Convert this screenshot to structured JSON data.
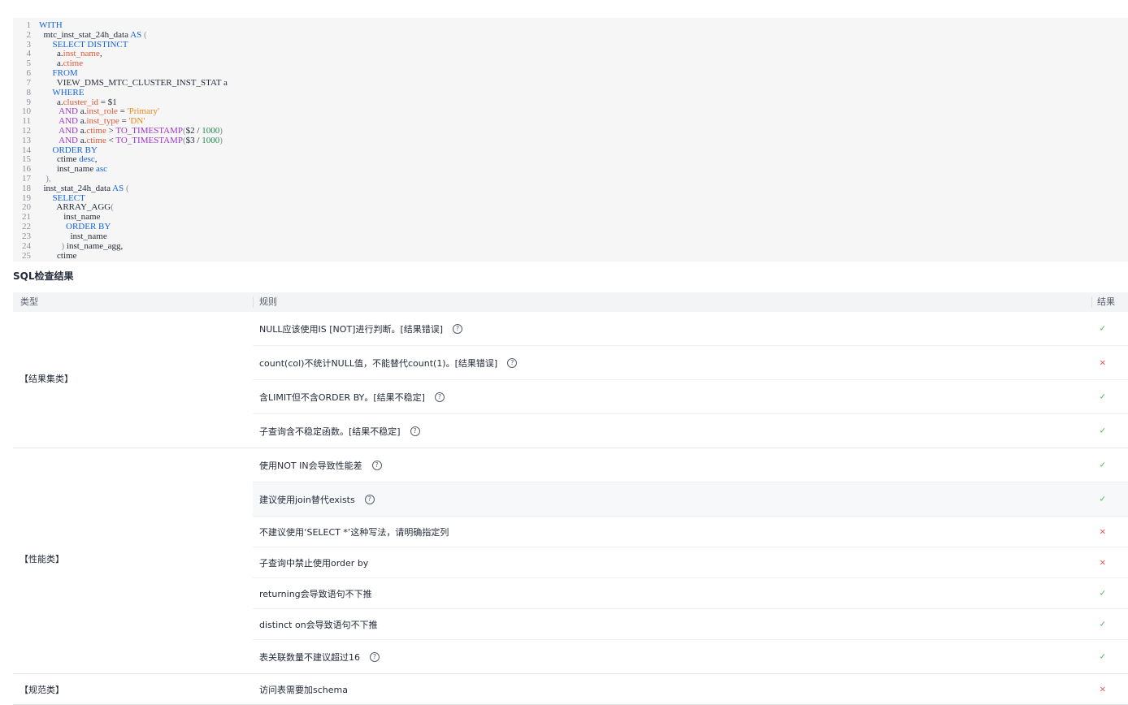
{
  "code": {
    "lines": [
      [
        [
          "kw",
          "WITH"
        ]
      ],
      [
        [
          "pl",
          "  mtc_inst_stat_24h_data "
        ],
        [
          "kw",
          "AS"
        ],
        [
          "par",
          " ("
        ]
      ],
      [
        [
          "pl",
          "      "
        ],
        [
          "kw",
          "SELECT DISTINCT"
        ]
      ],
      [
        [
          "pl",
          "        a."
        ],
        [
          "col",
          "inst_name"
        ],
        [
          "pl",
          ","
        ]
      ],
      [
        [
          "pl",
          "        a."
        ],
        [
          "col",
          "ctime"
        ]
      ],
      [
        [
          "pl",
          "      "
        ],
        [
          "kw",
          "FROM"
        ]
      ],
      [
        [
          "pl",
          "        VIEW_DMS_MTC_CLUSTER_INST_STAT a"
        ]
      ],
      [
        [
          "pl",
          "      "
        ],
        [
          "kw",
          "WHERE"
        ]
      ],
      [
        [
          "pl",
          "        a."
        ],
        [
          "col",
          "cluster_id"
        ],
        [
          "pl",
          " = $1"
        ]
      ],
      [
        [
          "pl",
          "         "
        ],
        [
          "fn",
          "AND"
        ],
        [
          "pl",
          " a."
        ],
        [
          "col",
          "inst_role"
        ],
        [
          "pl",
          " = "
        ],
        [
          "str",
          "'Primary'"
        ]
      ],
      [
        [
          "pl",
          "         "
        ],
        [
          "fn",
          "AND"
        ],
        [
          "pl",
          " a."
        ],
        [
          "col",
          "inst_type"
        ],
        [
          "pl",
          " = "
        ],
        [
          "str",
          "'DN'"
        ]
      ],
      [
        [
          "pl",
          "         "
        ],
        [
          "fn",
          "AND"
        ],
        [
          "pl",
          " a."
        ],
        [
          "col",
          "ctime"
        ],
        [
          "pl",
          " > "
        ],
        [
          "fn",
          "TO_TIMESTAMP"
        ],
        [
          "par",
          "("
        ],
        [
          "pl",
          "$2 / "
        ],
        [
          "num",
          "1000"
        ],
        [
          "par",
          ")"
        ]
      ],
      [
        [
          "pl",
          "         "
        ],
        [
          "fn",
          "AND"
        ],
        [
          "pl",
          " a."
        ],
        [
          "col",
          "ctime"
        ],
        [
          "pl",
          " < "
        ],
        [
          "fn",
          "TO_TIMESTAMP"
        ],
        [
          "par",
          "("
        ],
        [
          "pl",
          "$3 / "
        ],
        [
          "num",
          "1000"
        ],
        [
          "par",
          ")"
        ]
      ],
      [
        [
          "pl",
          "      "
        ],
        [
          "kw",
          "ORDER BY"
        ]
      ],
      [
        [
          "pl",
          "        ctime "
        ],
        [
          "kw",
          "desc"
        ],
        [
          "pl",
          ","
        ]
      ],
      [
        [
          "pl",
          "        inst_name "
        ],
        [
          "kw",
          "asc"
        ]
      ],
      [
        [
          "par",
          "   ),"
        ]
      ],
      [
        [
          "pl",
          "  inst_stat_24h_data "
        ],
        [
          "kw",
          "AS"
        ],
        [
          "par",
          " ("
        ]
      ],
      [
        [
          "pl",
          "      "
        ],
        [
          "kw",
          "SELECT"
        ]
      ],
      [
        [
          "pl",
          "        ARRAY_AGG"
        ],
        [
          "par",
          "("
        ]
      ],
      [
        [
          "pl",
          "           inst_name"
        ]
      ],
      [
        [
          "pl",
          "            "
        ],
        [
          "kw",
          "ORDER BY"
        ]
      ],
      [
        [
          "pl",
          "              inst_name"
        ]
      ],
      [
        [
          "par",
          "          )"
        ],
        [
          "pl",
          " inst_name_agg,"
        ]
      ],
      [
        [
          "pl",
          "        ctime"
        ]
      ]
    ]
  },
  "section_title": "SQL检查结果",
  "table": {
    "headers": {
      "type": "类型",
      "rule": "规则",
      "result": "结果"
    },
    "groups": [
      {
        "label": "【结果集类】",
        "rows": [
          {
            "text": "NULL应该使用IS [NOT]进行判断。[结果错误]",
            "help": true,
            "result": "pass"
          },
          {
            "text": "count(col)不统计NULL值，不能替代count(1)。[结果错误]",
            "help": true,
            "result": "fail"
          },
          {
            "text": "含LIMIT但不含ORDER BY。[结果不稳定]",
            "help": true,
            "result": "pass"
          },
          {
            "text": "子查询含不稳定函数。[结果不稳定]",
            "help": true,
            "result": "pass"
          }
        ]
      },
      {
        "label": "【性能类】",
        "rows": [
          {
            "text": "使用NOT IN会导致性能差",
            "help": true,
            "result": "pass"
          },
          {
            "text": "建议使用join替代exists",
            "help": true,
            "result": "pass",
            "highlight": true
          },
          {
            "text": "不建议使用‘SELECT *’这种写法，请明确指定列",
            "help": false,
            "result": "fail"
          },
          {
            "text": "子查询中禁止使用order by",
            "help": false,
            "result": "fail"
          },
          {
            "text": "returning会导致语句不下推",
            "help": false,
            "result": "pass"
          },
          {
            "text": "distinct on会导致语句不下推",
            "help": false,
            "result": "pass"
          },
          {
            "text": "表关联数量不建议超过16",
            "help": true,
            "result": "pass"
          }
        ]
      },
      {
        "label": "【规范类】",
        "rows": [
          {
            "text": "访问表需要加schema",
            "help": false,
            "result": "fail"
          }
        ]
      }
    ],
    "result_symbols": {
      "pass": "✓",
      "fail": "×"
    },
    "help_symbol": "?"
  }
}
